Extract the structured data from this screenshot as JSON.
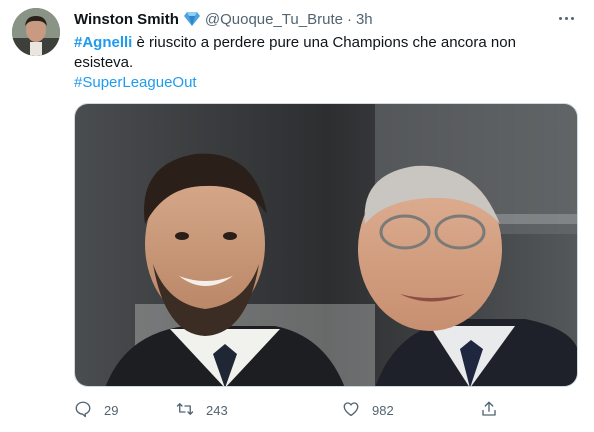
{
  "tweet": {
    "author_name": "Winston Smith",
    "handle": "@Quoque_Tu_Brute",
    "separator": "·",
    "time": "3h",
    "hashtag_1": "#Agnelli",
    "body_text": " è riuscito a perdere pure una Champions che ancora non esisteva.",
    "hashtag_2": "#SuperLeagueOut"
  },
  "actions": {
    "replies": "29",
    "retweets": "243",
    "likes": "982"
  },
  "icons": {
    "verified": "verified-diamond-icon",
    "more": "more-horizontal-icon",
    "reply": "reply-icon",
    "retweet": "retweet-icon",
    "like": "heart-icon",
    "share": "share-icon"
  },
  "colors": {
    "accent": "#1d9bf0",
    "secondary_text": "#536471",
    "primary_text": "#0f1419",
    "verified": "#4aa3df"
  }
}
